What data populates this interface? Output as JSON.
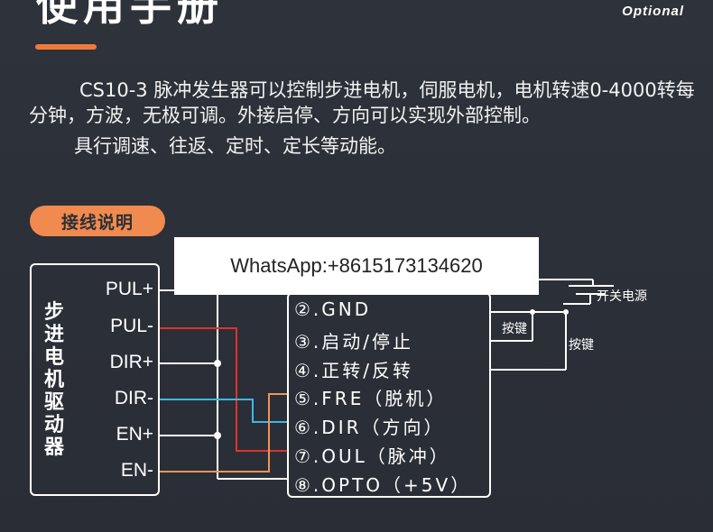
{
  "header": {
    "title": "使用手册",
    "optional": "Optional"
  },
  "description": {
    "para1": "CS10-3 脉冲发生器可以控制步进电机，伺服电机，电机转速0-4000转每分钟，方波，无极可调。外接启停、方向可以实现外部控制。",
    "para2": "具行调速、往返、定时、定长等动能。"
  },
  "section": {
    "label": "接线说明"
  },
  "driver": {
    "name": "步进电机驱动器",
    "pins": [
      "PUL+",
      "PUL-",
      "DIR+",
      "DIR-",
      "EN+",
      "EN-"
    ]
  },
  "terminals": [
    "②.GND",
    "③.启动/停止",
    "④.正转/反转",
    "⑤.FRE（脱机）",
    "⑥.DIR（方向）",
    "⑦.OUL（脉冲）",
    "⑧.OPTO（+5V）"
  ],
  "labels": {
    "power_switch": "开关电源",
    "key1": "按键",
    "key2": "按键"
  },
  "overlay": {
    "whatsapp": "WhatsApp:+8615173134620"
  },
  "colors": {
    "accent": "#f07a3a",
    "wire_red": "#e0322c",
    "wire_blue": "#3db8e8",
    "wire_orange": "#f0955a",
    "wire_white": "#ffffff"
  }
}
